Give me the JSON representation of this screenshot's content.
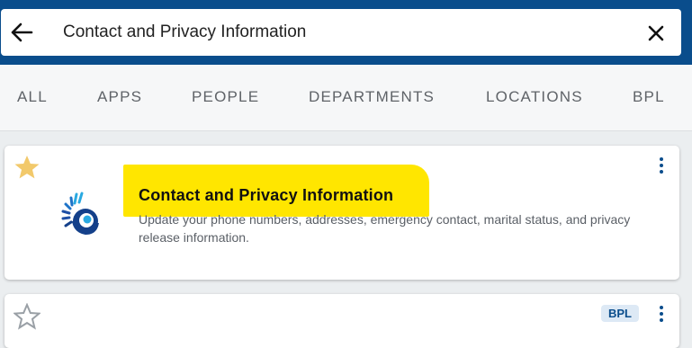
{
  "search": {
    "query": "Contact and Privacy Information"
  },
  "tabs": [
    {
      "label": "ALL"
    },
    {
      "label": "APPS"
    },
    {
      "label": "PEOPLE"
    },
    {
      "label": "DEPARTMENTS"
    },
    {
      "label": "LOCATIONS"
    },
    {
      "label": "BPL"
    }
  ],
  "results": [
    {
      "title": "Contact and Privacy Information",
      "description": "Update your phone numbers, addresses, emergency contact, marital status, and privacy release information.",
      "icon": "nautilus-shell-logo",
      "favorite_icon": "star-icon",
      "menu_icon": "kebab-menu-icon",
      "highlighted": true
    },
    {
      "badge": "BPL",
      "favorite_icon": "star-outline-icon",
      "menu_icon": "kebab-menu-icon"
    }
  ],
  "colors": {
    "brand": "#0a4d8c",
    "highlight": "#ffe600",
    "star_filled": "#f2c96b",
    "tab_text": "#5f6368"
  }
}
